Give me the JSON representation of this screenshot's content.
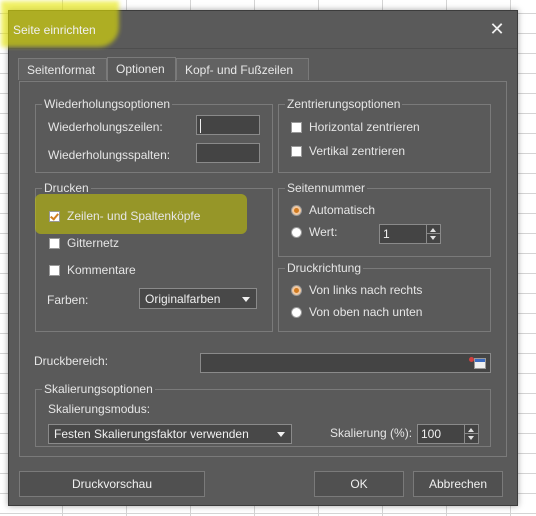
{
  "dialog": {
    "title": "Seite einrichten",
    "close_glyph": "✕"
  },
  "tabs": [
    {
      "label": "Seitenformat",
      "active": false
    },
    {
      "label": "Optionen",
      "active": true
    },
    {
      "label": "Kopf- und Fußzeilen",
      "active": false
    }
  ],
  "repeat": {
    "title": "Wiederholungsoptionen",
    "rows_label": "Wiederholungszeilen:",
    "rows_value": "",
    "cols_label": "Wiederholungsspalten:",
    "cols_value": ""
  },
  "centering": {
    "title": "Zentrierungsoptionen",
    "horizontal_label": "Horizontal zentrieren",
    "horizontal_checked": false,
    "vertical_label": "Vertikal zentrieren",
    "vertical_checked": false
  },
  "print": {
    "title": "Drucken",
    "headers_label": "Zeilen- und Spaltenköpfe",
    "headers_checked": true,
    "gridlines_label": "Gitternetz",
    "gridlines_checked": false,
    "comments_label": "Kommentare",
    "comments_checked": false,
    "colors_label": "Farben:",
    "colors_value": "Originalfarben"
  },
  "page_number": {
    "title": "Seitennummer",
    "auto_label": "Automatisch",
    "auto_selected": true,
    "value_label": "Wert:",
    "value": "1"
  },
  "direction": {
    "title": "Druckrichtung",
    "ltr_label": "Von links nach rechts",
    "ltr_selected": true,
    "ttb_label": "Von oben nach unten",
    "ttb_selected": false
  },
  "print_area": {
    "label": "Druckbereich:",
    "value": ""
  },
  "scaling": {
    "title": "Skalierungsoptionen",
    "mode_label": "Skalierungsmodus:",
    "mode_value": "Festen Skalierungsfaktor verwenden",
    "scale_label": "Skalierung (%):",
    "scale_value": "100"
  },
  "buttons": {
    "preview": "Druckvorschau",
    "ok": "OK",
    "cancel": "Abbrechen"
  },
  "colors": {
    "dialog_bg": "#5a5a5a",
    "highlight": "#e6e600",
    "accent": "#d07a20"
  }
}
